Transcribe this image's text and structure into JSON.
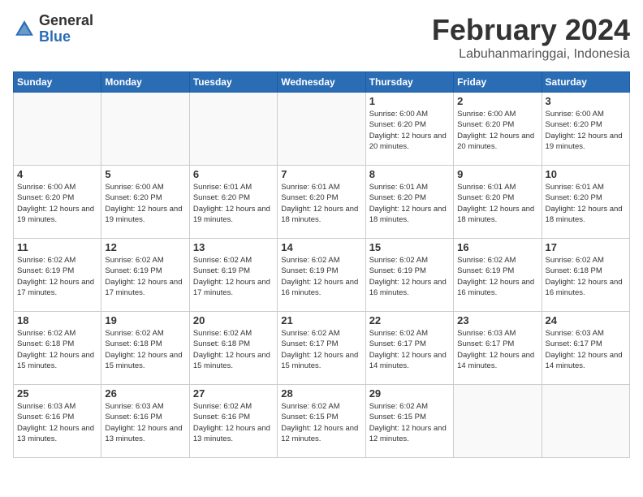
{
  "header": {
    "logo_general": "General",
    "logo_blue": "Blue",
    "title": "February 2024",
    "subtitle": "Labuhanmaringgai, Indonesia"
  },
  "weekdays": [
    "Sunday",
    "Monday",
    "Tuesday",
    "Wednesday",
    "Thursday",
    "Friday",
    "Saturday"
  ],
  "weeks": [
    [
      {
        "day": "",
        "info": ""
      },
      {
        "day": "",
        "info": ""
      },
      {
        "day": "",
        "info": ""
      },
      {
        "day": "",
        "info": ""
      },
      {
        "day": "1",
        "info": "Sunrise: 6:00 AM\nSunset: 6:20 PM\nDaylight: 12 hours\nand 20 minutes."
      },
      {
        "day": "2",
        "info": "Sunrise: 6:00 AM\nSunset: 6:20 PM\nDaylight: 12 hours\nand 20 minutes."
      },
      {
        "day": "3",
        "info": "Sunrise: 6:00 AM\nSunset: 6:20 PM\nDaylight: 12 hours\nand 19 minutes."
      }
    ],
    [
      {
        "day": "4",
        "info": "Sunrise: 6:00 AM\nSunset: 6:20 PM\nDaylight: 12 hours\nand 19 minutes."
      },
      {
        "day": "5",
        "info": "Sunrise: 6:00 AM\nSunset: 6:20 PM\nDaylight: 12 hours\nand 19 minutes."
      },
      {
        "day": "6",
        "info": "Sunrise: 6:01 AM\nSunset: 6:20 PM\nDaylight: 12 hours\nand 19 minutes."
      },
      {
        "day": "7",
        "info": "Sunrise: 6:01 AM\nSunset: 6:20 PM\nDaylight: 12 hours\nand 18 minutes."
      },
      {
        "day": "8",
        "info": "Sunrise: 6:01 AM\nSunset: 6:20 PM\nDaylight: 12 hours\nand 18 minutes."
      },
      {
        "day": "9",
        "info": "Sunrise: 6:01 AM\nSunset: 6:20 PM\nDaylight: 12 hours\nand 18 minutes."
      },
      {
        "day": "10",
        "info": "Sunrise: 6:01 AM\nSunset: 6:20 PM\nDaylight: 12 hours\nand 18 minutes."
      }
    ],
    [
      {
        "day": "11",
        "info": "Sunrise: 6:02 AM\nSunset: 6:19 PM\nDaylight: 12 hours\nand 17 minutes."
      },
      {
        "day": "12",
        "info": "Sunrise: 6:02 AM\nSunset: 6:19 PM\nDaylight: 12 hours\nand 17 minutes."
      },
      {
        "day": "13",
        "info": "Sunrise: 6:02 AM\nSunset: 6:19 PM\nDaylight: 12 hours\nand 17 minutes."
      },
      {
        "day": "14",
        "info": "Sunrise: 6:02 AM\nSunset: 6:19 PM\nDaylight: 12 hours\nand 16 minutes."
      },
      {
        "day": "15",
        "info": "Sunrise: 6:02 AM\nSunset: 6:19 PM\nDaylight: 12 hours\nand 16 minutes."
      },
      {
        "day": "16",
        "info": "Sunrise: 6:02 AM\nSunset: 6:19 PM\nDaylight: 12 hours\nand 16 minutes."
      },
      {
        "day": "17",
        "info": "Sunrise: 6:02 AM\nSunset: 6:18 PM\nDaylight: 12 hours\nand 16 minutes."
      }
    ],
    [
      {
        "day": "18",
        "info": "Sunrise: 6:02 AM\nSunset: 6:18 PM\nDaylight: 12 hours\nand 15 minutes."
      },
      {
        "day": "19",
        "info": "Sunrise: 6:02 AM\nSunset: 6:18 PM\nDaylight: 12 hours\nand 15 minutes."
      },
      {
        "day": "20",
        "info": "Sunrise: 6:02 AM\nSunset: 6:18 PM\nDaylight: 12 hours\nand 15 minutes."
      },
      {
        "day": "21",
        "info": "Sunrise: 6:02 AM\nSunset: 6:17 PM\nDaylight: 12 hours\nand 15 minutes."
      },
      {
        "day": "22",
        "info": "Sunrise: 6:02 AM\nSunset: 6:17 PM\nDaylight: 12 hours\nand 14 minutes."
      },
      {
        "day": "23",
        "info": "Sunrise: 6:03 AM\nSunset: 6:17 PM\nDaylight: 12 hours\nand 14 minutes."
      },
      {
        "day": "24",
        "info": "Sunrise: 6:03 AM\nSunset: 6:17 PM\nDaylight: 12 hours\nand 14 minutes."
      }
    ],
    [
      {
        "day": "25",
        "info": "Sunrise: 6:03 AM\nSunset: 6:16 PM\nDaylight: 12 hours\nand 13 minutes."
      },
      {
        "day": "26",
        "info": "Sunrise: 6:03 AM\nSunset: 6:16 PM\nDaylight: 12 hours\nand 13 minutes."
      },
      {
        "day": "27",
        "info": "Sunrise: 6:02 AM\nSunset: 6:16 PM\nDaylight: 12 hours\nand 13 minutes."
      },
      {
        "day": "28",
        "info": "Sunrise: 6:02 AM\nSunset: 6:15 PM\nDaylight: 12 hours\nand 12 minutes."
      },
      {
        "day": "29",
        "info": "Sunrise: 6:02 AM\nSunset: 6:15 PM\nDaylight: 12 hours\nand 12 minutes."
      },
      {
        "day": "",
        "info": ""
      },
      {
        "day": "",
        "info": ""
      }
    ]
  ]
}
